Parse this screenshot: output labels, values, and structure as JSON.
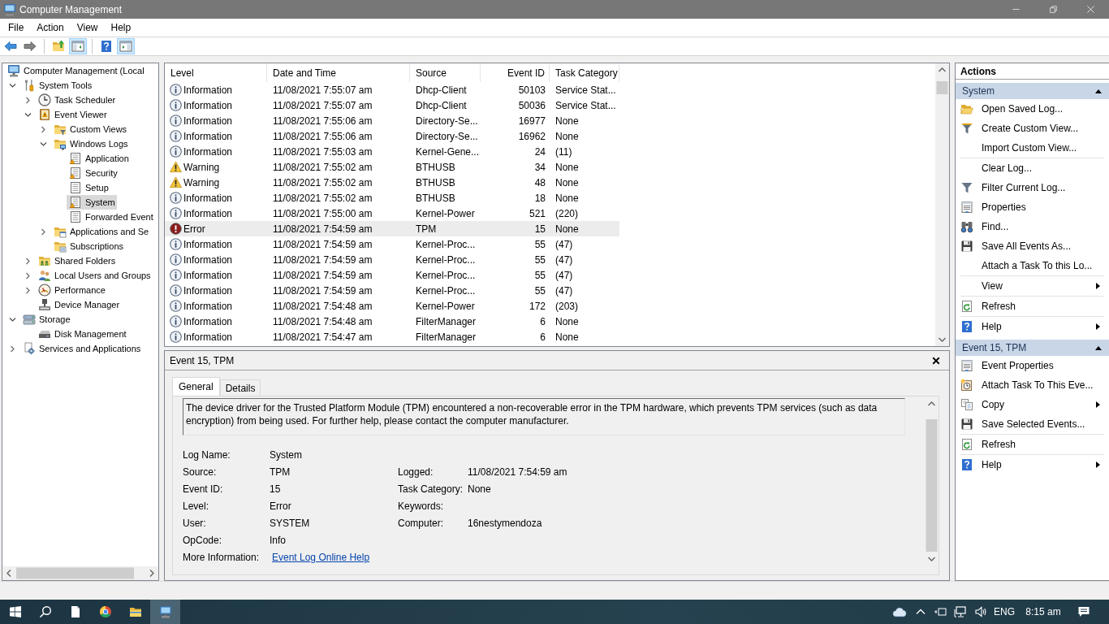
{
  "window": {
    "title": "Computer Management"
  },
  "menu": [
    "File",
    "Action",
    "View",
    "Help"
  ],
  "toolbar": [
    [
      {
        "pressed": false,
        "disabled": false
      },
      {
        "pressed": false,
        "disabled": true
      }
    ],
    [
      {
        "pressed": false,
        "disabled": false
      },
      {
        "pressed": true,
        "disabled": false
      }
    ],
    [
      {
        "pressed": false,
        "disabled": false
      },
      {
        "pressed": true,
        "disabled": false
      }
    ]
  ],
  "tree": [
    {
      "label": "Computer Management (Local",
      "selected": false,
      "children": [
        {
          "label": "System Tools",
          "expanded": true,
          "selected": false,
          "children": [
            {
              "label": "Task Scheduler",
              "expanded": false,
              "selected": false
            },
            {
              "label": "Event Viewer",
              "expanded": true,
              "selected": false,
              "children": [
                {
                  "label": "Custom Views",
                  "expanded": false,
                  "selected": false
                },
                {
                  "label": "Windows Logs",
                  "expanded": true,
                  "selected": false,
                  "children": [
                    {
                      "label": "Application",
                      "selected": false
                    },
                    {
                      "label": "Security",
                      "selected": false
                    },
                    {
                      "label": "Setup",
                      "selected": false
                    },
                    {
                      "label": "System",
                      "selected": true
                    },
                    {
                      "label": "Forwarded Event",
                      "selected": false
                    }
                  ]
                },
                {
                  "label": "Applications and Se",
                  "expanded": false,
                  "selected": false
                },
                {
                  "label": "Subscriptions",
                  "selected": false
                }
              ]
            },
            {
              "label": "Shared Folders",
              "expanded": false,
              "selected": false
            },
            {
              "label": "Local Users and Groups",
              "expanded": false,
              "selected": false
            },
            {
              "label": "Performance",
              "expanded": false,
              "selected": false
            },
            {
              "label": "Device Manager",
              "selected": false
            }
          ]
        },
        {
          "label": "Storage",
          "expanded": true,
          "selected": false,
          "children": [
            {
              "label": "Disk Management",
              "selected": false
            }
          ]
        },
        {
          "label": "Services and Applications",
          "expanded": false,
          "selected": false
        }
      ]
    }
  ],
  "events": {
    "columns": [
      "Level",
      "Date and Time",
      "Source",
      "Event ID",
      "Task Category"
    ],
    "rows": [
      {
        "kind": "information",
        "selected": false,
        "cells": [
          "Information",
          "11/08/2021 7:55:07 am",
          "Dhcp-Client",
          "50103",
          "Service Stat..."
        ]
      },
      {
        "kind": "information",
        "selected": false,
        "cells": [
          "Information",
          "11/08/2021 7:55:07 am",
          "Dhcp-Client",
          "50036",
          "Service Stat..."
        ]
      },
      {
        "kind": "information",
        "selected": false,
        "cells": [
          "Information",
          "11/08/2021 7:55:06 am",
          "Directory-Se...",
          "16977",
          "None"
        ]
      },
      {
        "kind": "information",
        "selected": false,
        "cells": [
          "Information",
          "11/08/2021 7:55:06 am",
          "Directory-Se...",
          "16962",
          "None"
        ]
      },
      {
        "kind": "information",
        "selected": false,
        "cells": [
          "Information",
          "11/08/2021 7:55:03 am",
          "Kernel-Gene...",
          "24",
          "(11)"
        ]
      },
      {
        "kind": "warning",
        "selected": false,
        "cells": [
          "Warning",
          "11/08/2021 7:55:02 am",
          "BTHUSB",
          "34",
          "None"
        ]
      },
      {
        "kind": "warning",
        "selected": false,
        "cells": [
          "Warning",
          "11/08/2021 7:55:02 am",
          "BTHUSB",
          "48",
          "None"
        ]
      },
      {
        "kind": "information",
        "selected": false,
        "cells": [
          "Information",
          "11/08/2021 7:55:02 am",
          "BTHUSB",
          "18",
          "None"
        ]
      },
      {
        "kind": "information",
        "selected": false,
        "cells": [
          "Information",
          "11/08/2021 7:55:00 am",
          "Kernel-Power",
          "521",
          "(220)"
        ]
      },
      {
        "kind": "error",
        "selected": true,
        "cells": [
          "Error",
          "11/08/2021 7:54:59 am",
          "TPM",
          "15",
          "None"
        ]
      },
      {
        "kind": "information",
        "selected": false,
        "cells": [
          "Information",
          "11/08/2021 7:54:59 am",
          "Kernel-Proc...",
          "55",
          "(47)"
        ]
      },
      {
        "kind": "information",
        "selected": false,
        "cells": [
          "Information",
          "11/08/2021 7:54:59 am",
          "Kernel-Proc...",
          "55",
          "(47)"
        ]
      },
      {
        "kind": "information",
        "selected": false,
        "cells": [
          "Information",
          "11/08/2021 7:54:59 am",
          "Kernel-Proc...",
          "55",
          "(47)"
        ]
      },
      {
        "kind": "information",
        "selected": false,
        "cells": [
          "Information",
          "11/08/2021 7:54:59 am",
          "Kernel-Proc...",
          "55",
          "(47)"
        ]
      },
      {
        "kind": "information",
        "selected": false,
        "cells": [
          "Information",
          "11/08/2021 7:54:48 am",
          "Kernel-Power",
          "172",
          "(203)"
        ]
      },
      {
        "kind": "information",
        "selected": false,
        "cells": [
          "Information",
          "11/08/2021 7:54:48 am",
          "FilterManager",
          "6",
          "None"
        ]
      },
      {
        "kind": "information",
        "selected": false,
        "cells": [
          "Information",
          "11/08/2021 7:54:47 am",
          "FilterManager",
          "6",
          "None"
        ]
      }
    ]
  },
  "details": {
    "title": "Event 15, TPM",
    "tabs": [
      {
        "label": "General",
        "selected": true
      },
      {
        "label": "Details",
        "selected": false
      }
    ],
    "description": "The device driver for the Trusted Platform Module (TPM) encountered a non-recoverable error in the TPM hardware, which prevents TPM services (such as data encryption) from being used. For further help, please contact the computer manufacturer.",
    "fields": [
      {
        "label": "Log Name:",
        "value": "System"
      },
      {
        "label": "Source:",
        "value": "TPM",
        "right_label": "Logged:",
        "right_value": "11/08/2021 7:54:59 am"
      },
      {
        "label": "Event ID:",
        "value": "15",
        "right_label": "Task Category:",
        "right_value": "None"
      },
      {
        "label": "Level:",
        "value": "Error",
        "right_label": "Keywords:"
      },
      {
        "label": "User:",
        "value": "SYSTEM",
        "right_label": "Computer:",
        "right_value": "16nestymendoza"
      },
      {
        "label": "OpCode:",
        "value": "Info"
      },
      {
        "label": "More Information:",
        "link": "Event Log Online Help"
      }
    ]
  },
  "actions": {
    "title": "Actions",
    "sections": [
      {
        "title": "System",
        "expanded": true,
        "groups": [
          [
            {
              "label": "Open Saved Log...",
              "submenu": false
            },
            {
              "label": "Create Custom View...",
              "submenu": false
            },
            {
              "label": "Import Custom View...",
              "submenu": false
            }
          ],
          [
            {
              "label": "Clear Log...",
              "submenu": false
            },
            {
              "label": "Filter Current Log...",
              "submenu": false
            },
            {
              "label": "Properties",
              "submenu": false
            },
            {
              "label": "Find...",
              "submenu": false
            },
            {
              "label": "Save All Events As...",
              "submenu": false
            },
            {
              "label": "Attach a Task To this Lo...",
              "submenu": false
            }
          ],
          [
            {
              "label": "View",
              "submenu": true
            }
          ],
          [
            {
              "label": "Refresh",
              "submenu": false
            }
          ],
          [
            {
              "label": "Help",
              "submenu": true
            }
          ]
        ]
      },
      {
        "title": "Event 15, TPM",
        "expanded": true,
        "groups": [
          [
            {
              "label": "Event Properties",
              "submenu": false
            },
            {
              "label": "Attach Task To This Eve...",
              "submenu": false
            },
            {
              "label": "Copy",
              "submenu": true
            },
            {
              "label": "Save Selected Events...",
              "submenu": false
            }
          ],
          [
            {
              "label": "Refresh",
              "submenu": false
            }
          ],
          [
            {
              "label": "Help",
              "submenu": true
            }
          ]
        ]
      }
    ]
  },
  "taskbar": {
    "apps": [
      {
        "selected": false
      },
      {
        "selected": false
      },
      {
        "selected": false
      },
      {
        "selected": true
      }
    ],
    "language": "ENG",
    "time": "8:15 am"
  }
}
